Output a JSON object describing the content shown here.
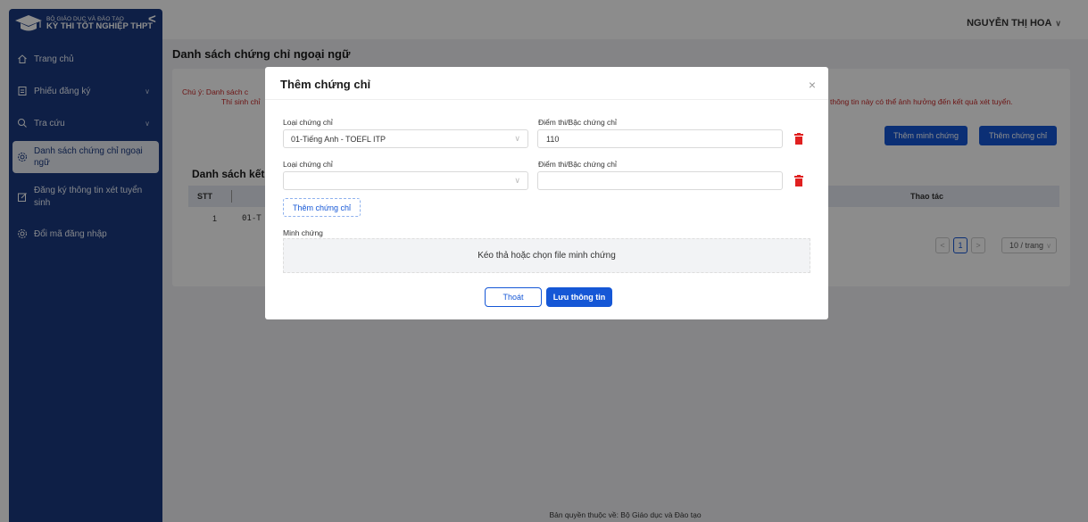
{
  "header": {
    "org_line1": "BỘ GIÁO DỤC VÀ ĐÀO TẠO",
    "org_line2": "KỲ THI TỐT NGHIỆP THPT",
    "collapse_glyph": "<",
    "user_name": "NGUYỄN THỊ HOA",
    "user_caret": "∨"
  },
  "sidebar": {
    "items": [
      {
        "label": "Trang chủ",
        "icon": "home-icon"
      },
      {
        "label": "Phiếu đăng ký",
        "icon": "document-icon",
        "caret": "∨"
      },
      {
        "label": "Tra cứu",
        "icon": "search-icon",
        "caret": "∨"
      },
      {
        "label_line1": "Danh sách chứng chỉ ngoại",
        "label_line2": "ngữ",
        "icon": "settings-icon",
        "active": true
      },
      {
        "label_line1": "Đăng ký thông tin xét tuyển",
        "label_line2": "sinh",
        "icon": "edit-icon"
      },
      {
        "label": "Đổi mã đăng nhập",
        "icon": "settings-icon"
      }
    ]
  },
  "page": {
    "title": "Danh sách chứng chỉ ngoại ngữ",
    "notice_label": "Chú ý:  Danh sách c",
    "notice_cont": "Thí sinh chỉ",
    "notice_right": "thông tin này có thể ảnh hưởng đến kết quả xét tuyển.",
    "btn_add_evidence": "Thêm minh chứng",
    "btn_add_certificate": "Thêm chứng chỉ",
    "list_title": "Danh sách kết c",
    "table_headers": {
      "stt": "STT",
      "actions": "Thao tác"
    },
    "row": {
      "stt": "1",
      "partial": "01-T"
    },
    "pager": {
      "prev": "<",
      "current": "1",
      "next": ">",
      "size": "10 / trang",
      "size_caret": "∨"
    },
    "footer": "Bản quyền thuộc về: Bộ Giáo dục và Đào tạo"
  },
  "modal": {
    "title": "Thêm chứng chỉ",
    "close": "×",
    "rows": [
      {
        "type_label": "Loại chứng chỉ",
        "type_value": "01-Tiếng Anh - TOEFL ITP",
        "score_label": "Điểm thi/Bậc chứng chỉ",
        "score_value": "110"
      },
      {
        "type_label": "Loại chứng chỉ",
        "type_value": "",
        "score_label": "Điểm thi/Bậc chứng chỉ",
        "score_value": ""
      }
    ],
    "select_caret": "∨",
    "add_certificate": "Thêm chứng chỉ",
    "evidence_label": "Minh chứng",
    "upload_text": "Kéo thả hoặc chọn file minh chứng",
    "btn_exit": "Thoát",
    "btn_save": "Lưu thông tin"
  },
  "colors": {
    "sidebar": "#1a3a80",
    "primary": "#1557d6",
    "danger": "#e02020",
    "notice": "#c62828"
  }
}
